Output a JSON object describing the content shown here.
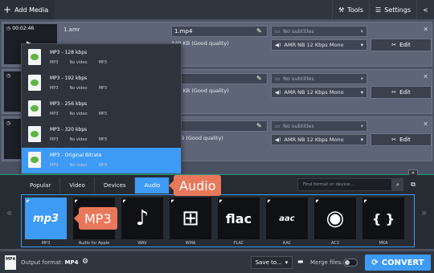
{
  "toolbar": {
    "add_media": "Add Media",
    "tools": "Tools",
    "settings": "Settings"
  },
  "files": [
    {
      "duration": "00:02:46",
      "name": "1.amr",
      "output_name": "1.mp4",
      "size": "349 KB (Good quality)",
      "subtitles": "No subtitles",
      "audio": "AMR NB 12 Kbps Mono",
      "edit": "Edit"
    },
    {
      "duration": "",
      "name": "",
      "output_name": "",
      "size": "349 KB (Good quality)",
      "subtitles": "No subtitles",
      "audio": "AMR NB 12 Kbps Mono",
      "edit": "Edit"
    },
    {
      "duration": "",
      "name": "",
      "output_name": "",
      "size": "1 MB (Good quality)",
      "subtitles": "No subtitles",
      "audio": "AMR NB 12 Kbps Mono",
      "edit": "Edit"
    }
  ],
  "presets": [
    {
      "title": "MP3 - 128 kbps",
      "meta": [
        "MP3",
        "No video",
        "MP3"
      ]
    },
    {
      "title": "MP3 - 192 kbps",
      "meta": [
        "MP3",
        "No video",
        "MP3"
      ]
    },
    {
      "title": "MP3 - 256 kbps",
      "meta": [
        "MP3",
        "No video",
        "MP3"
      ]
    },
    {
      "title": "MP3 - 320 kbps",
      "meta": [
        "MP3",
        "No video",
        "MP3"
      ]
    },
    {
      "title": "MP3 - Original Bitrate",
      "meta": [
        "MP3",
        "No video",
        "MP3"
      ]
    }
  ],
  "tabs": [
    "Popular",
    "Video",
    "Devices",
    "Audio"
  ],
  "search_placeholder": "Find format or device...",
  "formats": [
    {
      "label": "MP3",
      "glyph": "mp3"
    },
    {
      "label": "Audio for Apple",
      "glyph": "♫"
    },
    {
      "label": "WAV",
      "glyph": "♪"
    },
    {
      "label": "WMA",
      "glyph": "⊞"
    },
    {
      "label": "FLAC",
      "glyph": "flac"
    },
    {
      "label": "AAC",
      "glyph": "aac"
    },
    {
      "label": "AC3",
      "glyph": "◉"
    },
    {
      "label": "MKA",
      "glyph": "{ }"
    }
  ],
  "callouts": {
    "audio": "Audio",
    "mp3": "MP3"
  },
  "bottom": {
    "icon_text": "MP4",
    "output_format_label": "Output format:",
    "output_format_value": "MP4",
    "save_to": "Save to...",
    "merge_files": "Merge files:",
    "convert": "CONVERT"
  },
  "colors": {
    "accent": "#3d9bf5",
    "callout": "#e9785b",
    "divider": "#1f9d7a"
  }
}
